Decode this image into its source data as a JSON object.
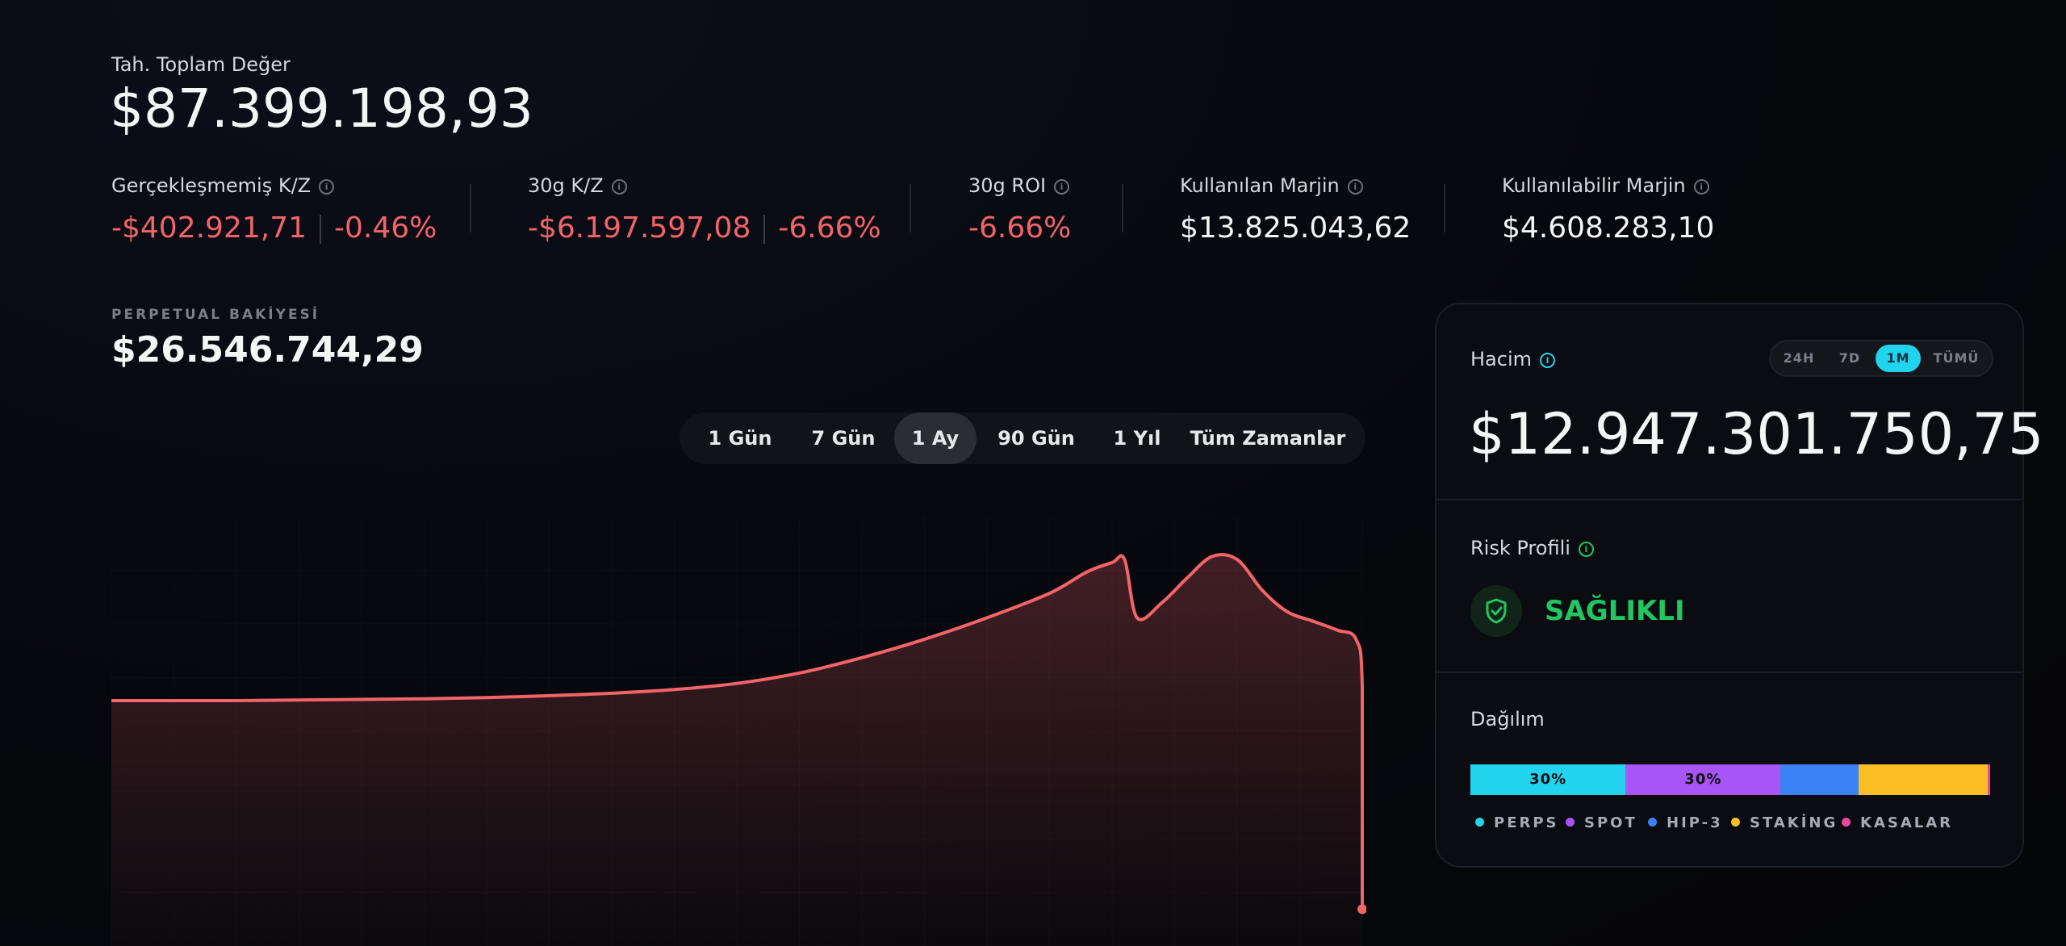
{
  "total": {
    "label": "Tah. Toplam Değer",
    "value": "$87.399.198,93"
  },
  "kpis": {
    "unrealized": {
      "label": "Gerçekleşmemiş K/Z",
      "amount": "-$402.921,71",
      "percent": "-0.46%"
    },
    "pnl30": {
      "label": "30g K/Z",
      "amount": "-$6.197.597,08",
      "percent": "-6.66%"
    },
    "roi30": {
      "label": "30g ROI",
      "value": "-6.66%"
    },
    "used_margin": {
      "label": "Kullanılan Marjin",
      "value": "$13.825.043,62"
    },
    "available_margin": {
      "label": "Kullanılabilir Marjin",
      "value": "$4.608.283,10"
    }
  },
  "perp": {
    "label": "PERPETUAL BAKİYESİ",
    "value": "$26.546.744,29"
  },
  "ranges": [
    "1 Gün",
    "7 Gün",
    "1 Ay",
    "90 Gün",
    "1 Yıl",
    "Tüm Zamanlar"
  ],
  "active_range": "1 Ay",
  "chart_data": {
    "type": "area",
    "title": "",
    "xlabel": "",
    "ylabel": "",
    "grid": true,
    "color": "#f26468",
    "x": [
      0,
      5,
      10,
      15,
      20,
      25,
      30,
      35,
      40,
      45,
      50,
      55,
      60,
      65,
      70,
      75,
      78,
      80,
      81,
      82,
      84,
      86,
      88,
      90,
      92,
      94,
      96,
      98,
      99.5,
      100,
      100
    ],
    "y": [
      100,
      100,
      100,
      100.1,
      100.2,
      100.3,
      100.5,
      100.8,
      101.2,
      101.8,
      102.8,
      104.5,
      107,
      110,
      113.5,
      117.5,
      121,
      122.5,
      123,
      113.5,
      116,
      120,
      123.5,
      123,
      118,
      114.5,
      113,
      111.5,
      110,
      102,
      66
    ],
    "ylim": [
      60,
      130
    ]
  },
  "volume": {
    "label": "Hacim",
    "timeframes": [
      "24H",
      "7D",
      "1M",
      "TÜMÜ"
    ],
    "active_timeframe": "1M",
    "value": "$12.947.301.750,75"
  },
  "risk": {
    "label": "Risk Profili",
    "status": "SAĞLIKLI",
    "color": "#22c55e"
  },
  "allocation": {
    "label": "Dağılım",
    "segments": [
      {
        "name": "PERPS",
        "percent": 30,
        "label": "30%",
        "color": "#22d3ee"
      },
      {
        "name": "SPOT",
        "percent": 30,
        "label": "30%",
        "color": "#a855f7"
      },
      {
        "name": "HIP-3",
        "percent": 15,
        "label": "",
        "color": "#3b82f6"
      },
      {
        "name": "STAKİNG",
        "percent": 25,
        "label": "",
        "color": "#fbbf24"
      },
      {
        "name": "KASALAR",
        "percent": 0.5,
        "label": "",
        "color": "#ec4899"
      }
    ]
  }
}
